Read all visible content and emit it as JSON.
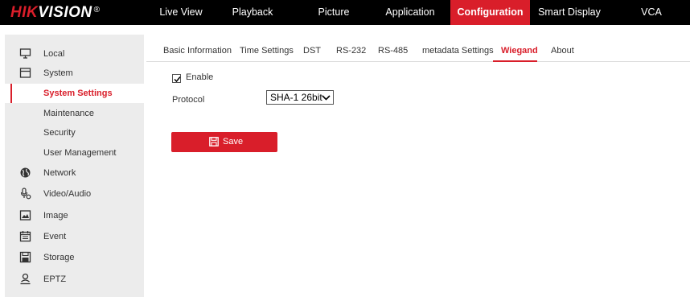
{
  "brand": {
    "part1": "HIK",
    "part2": "VISION",
    "reg": "®"
  },
  "nav": [
    "Live View",
    "Playback",
    "Picture",
    "Application",
    "Configuration",
    "Smart Display",
    "VCA"
  ],
  "active_nav": "Configuration",
  "sidebar": {
    "items": [
      {
        "label": "Local",
        "icon": "monitor-icon"
      },
      {
        "label": "System",
        "icon": "system-icon"
      },
      {
        "label": "System Settings",
        "selected": true
      },
      {
        "label": "Maintenance"
      },
      {
        "label": "Security"
      },
      {
        "label": "User Management"
      },
      {
        "label": "Network",
        "icon": "globe-icon"
      },
      {
        "label": "Video/Audio",
        "icon": "microphone-icon"
      },
      {
        "label": "Image",
        "icon": "image-icon"
      },
      {
        "label": "Event",
        "icon": "calendar-icon"
      },
      {
        "label": "Storage",
        "icon": "disk-icon"
      },
      {
        "label": "EPTZ",
        "icon": "person-icon"
      }
    ]
  },
  "tabs": [
    "Basic Information",
    "Time Settings",
    "DST",
    "RS-232",
    "RS-485",
    "metadata Settings",
    "Wiegand",
    "About"
  ],
  "active_tab": "Wiegand",
  "form": {
    "enable_label": "Enable",
    "enable_checked": true,
    "protocol_label": "Protocol",
    "protocol_value": "SHA-1 26bit"
  },
  "save_label": "Save",
  "colors": {
    "accent": "#d91e2a",
    "topbar": "#000000",
    "sidebar_bg": "#ececec"
  }
}
